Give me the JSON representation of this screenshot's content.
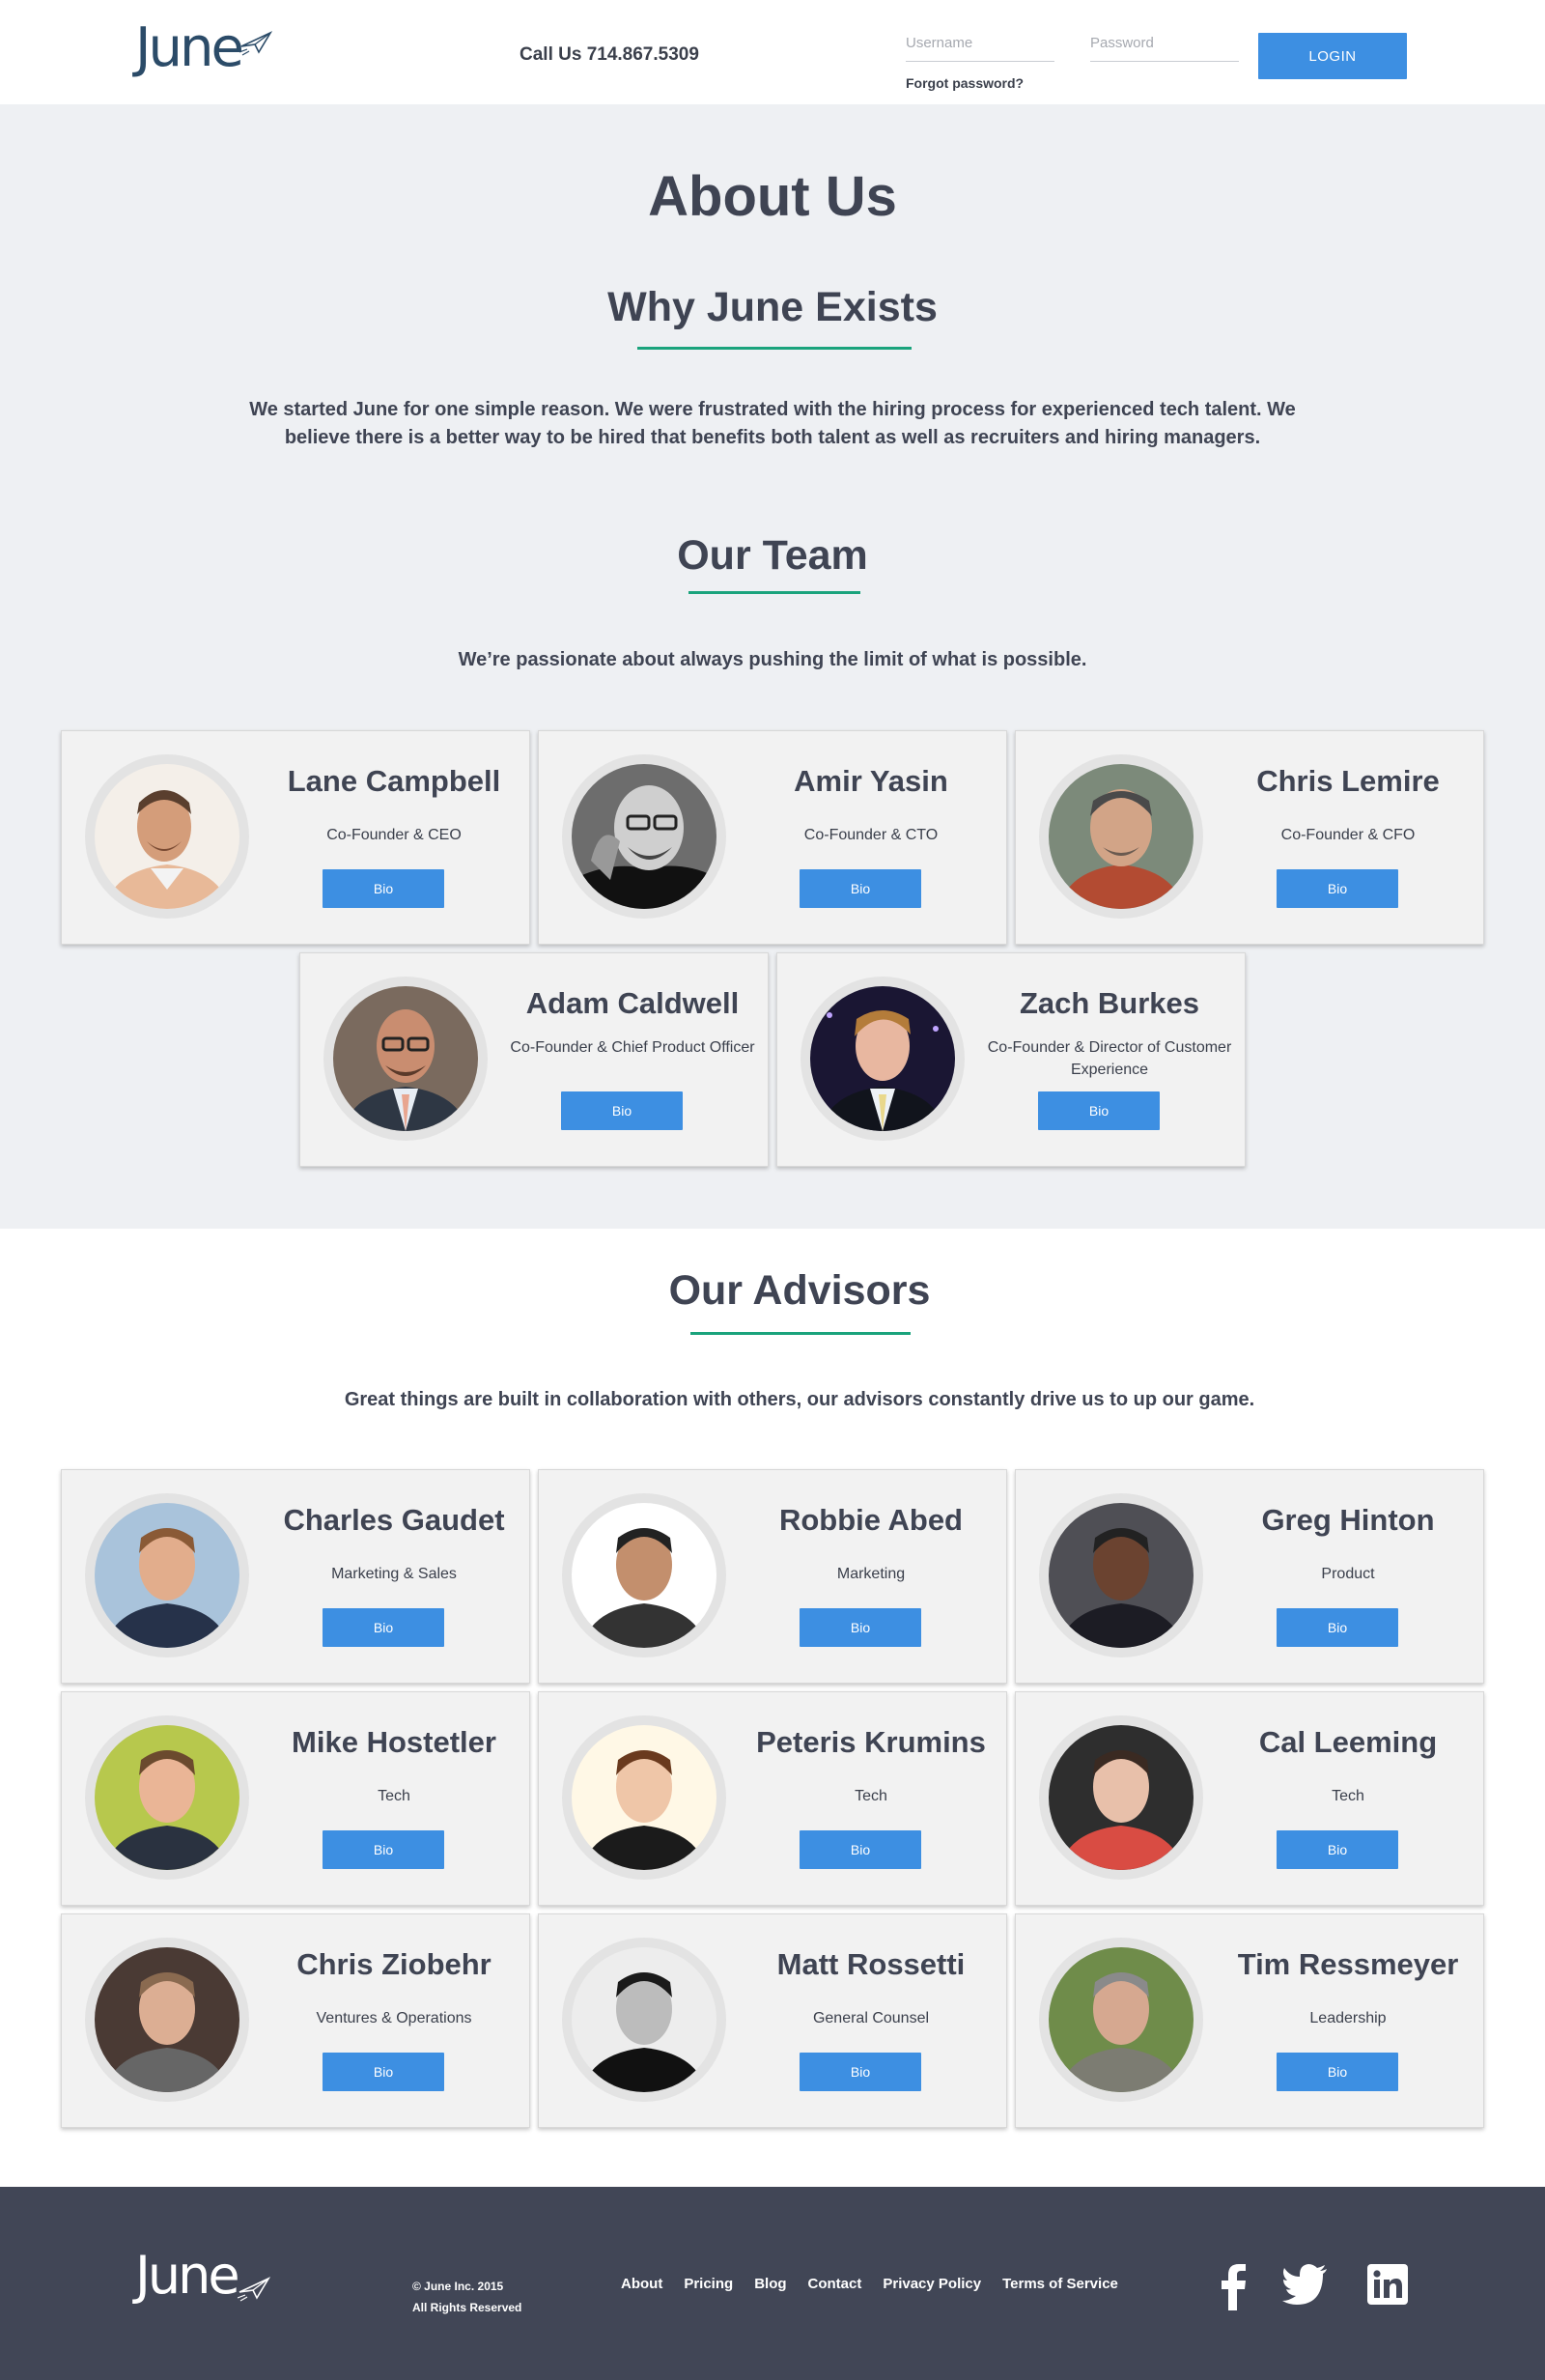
{
  "header": {
    "logo": "June",
    "call_us": "Call Us 714.867.5309",
    "username_placeholder": "Username",
    "password_placeholder": "Password",
    "forgot": "Forgot password?",
    "login": "LOGIN"
  },
  "about": {
    "title": "About Us",
    "why_heading": "Why June Exists",
    "why_text_line1": "We started June for one simple reason. We were frustrated with the hiring process for experienced tech talent. We",
    "why_text_line2": "believe there is a better way to be hired that benefits both talent as well as recruiters and hiring managers.",
    "team_heading": "Our Team",
    "team_text": "We’re passionate about always pushing the limit of what is possible."
  },
  "team": [
    {
      "name": "Lane Campbell",
      "role": "Co-Founder & CEO",
      "bio": "Bio"
    },
    {
      "name": "Amir Yasin",
      "role": "Co-Founder & CTO",
      "bio": "Bio"
    },
    {
      "name": "Chris Lemire",
      "role": "Co-Founder & CFO",
      "bio": "Bio"
    },
    {
      "name": "Adam Caldwell",
      "role": "Co-Founder & Chief Product Officer",
      "bio": "Bio"
    },
    {
      "name": "Zach Burkes",
      "role": "Co-Founder & Director of Customer Experience",
      "bio": "Bio"
    }
  ],
  "advisors_section": {
    "heading": "Our Advisors",
    "text": "Great things are built in collaboration with others, our advisors constantly drive us to up our game."
  },
  "advisors": [
    {
      "name": "Charles Gaudet",
      "role": "Marketing & Sales",
      "bio": "Bio"
    },
    {
      "name": "Robbie Abed",
      "role": "Marketing",
      "bio": "Bio"
    },
    {
      "name": "Greg Hinton",
      "role": "Product",
      "bio": "Bio"
    },
    {
      "name": "Mike Hostetler",
      "role": "Tech",
      "bio": "Bio"
    },
    {
      "name": "Peteris Krumins",
      "role": "Tech",
      "bio": "Bio"
    },
    {
      "name": "Cal Leeming",
      "role": "Tech",
      "bio": "Bio"
    },
    {
      "name": "Chris Ziobehr",
      "role": "Ventures & Operations",
      "bio": "Bio"
    },
    {
      "name": "Matt Rossetti",
      "role": "General Counsel",
      "bio": "Bio"
    },
    {
      "name": "Tim Ressmeyer",
      "role": "Leadership",
      "bio": "Bio"
    }
  ],
  "footer": {
    "logo": "June",
    "copyright": "© June Inc. 2015",
    "rights": "All Rights Reserved",
    "links": [
      "About",
      "Pricing",
      "Blog",
      "Contact",
      "Privacy Policy",
      "Terms of Service"
    ],
    "social_icons": [
      "facebook-icon",
      "twitter-icon",
      "linkedin-icon"
    ]
  },
  "colors": {
    "brand": "#2b4b68",
    "button": "#3d8fe2",
    "accent_underline": "#1aa37c",
    "footer_bg": "#414656",
    "section_bg": "#eef0f3"
  }
}
